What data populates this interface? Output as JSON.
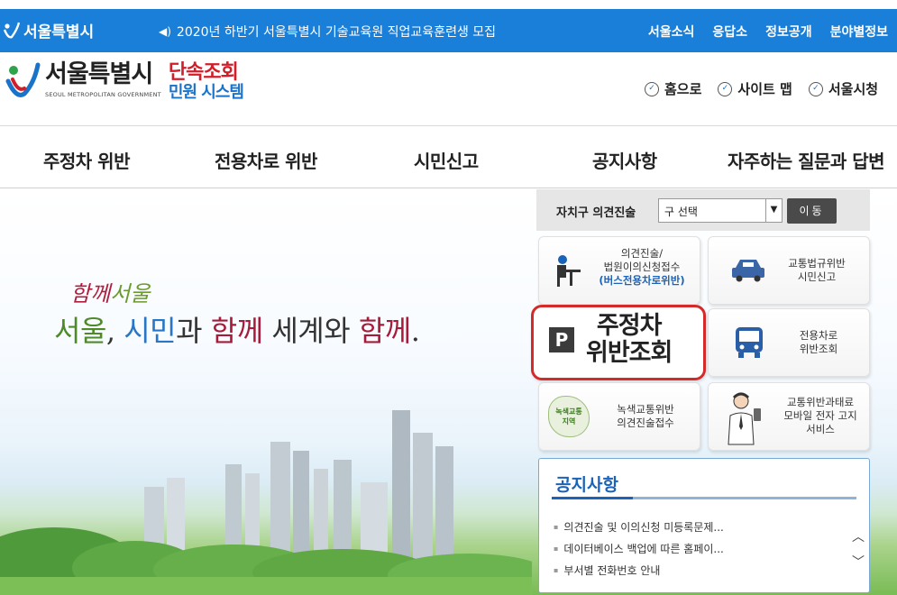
{
  "topbar": {
    "logo": "서울특별시",
    "notice": "2020년 하반기 서울특별시 기술교육원 직업교육훈련생 모집",
    "links": [
      "서울소식",
      "응답소",
      "정보공개",
      "분야별정보"
    ]
  },
  "brand": {
    "name": "서울특별시",
    "name_en": "SEOUL METROPOLITAN GOVERNMENT",
    "system_line1": "단속조회",
    "system_line2": "민원 시스템"
  },
  "utility": [
    "홈으로",
    "사이트 맵",
    "서울시청"
  ],
  "nav": [
    "주정차 위반",
    "전용차로 위반",
    "시민신고",
    "공지사항",
    "자주하는 질문과 답변"
  ],
  "hero": {
    "sub_1": "함께",
    "sub_2": "서울",
    "main": [
      "서울",
      ", ",
      "시민",
      "과 ",
      "함께",
      " 세계와 ",
      "함께",
      "."
    ]
  },
  "district": {
    "label": "자치구 의견진술",
    "select_value": "구 선택",
    "go_label": "이동"
  },
  "tiles": {
    "opinion": {
      "line1": "의견진술/",
      "line2": "법원이의신청접수",
      "line3": "(버스전용차로위반)"
    },
    "report": {
      "line1": "교통법규위반",
      "line2": "시민신고"
    },
    "parking": {
      "icon": "P",
      "line1": "주정차",
      "line2": "위반조회"
    },
    "lane": {
      "line1": "전용차로",
      "line2": "위반조회"
    },
    "green": {
      "badge": "녹색교통\n지역",
      "line1": "녹색교통위반",
      "line2": "의견진술접수"
    },
    "mobile": {
      "line1": "교통위반과태료",
      "line2": "모바일 전자 고지",
      "line3": "서비스"
    }
  },
  "notices": {
    "title": "공지사항",
    "items": [
      "의견진술 및 이의신청 미등록문제...",
      "데이터베이스 백업에 따른 홈페이...",
      "부서별 전화번호 안내"
    ]
  },
  "colors": {
    "topbar": "#1a7fd8",
    "brand_red": "#d11f2a",
    "brand_blue": "#1a73c8",
    "highlight_border": "#d42a2a"
  }
}
